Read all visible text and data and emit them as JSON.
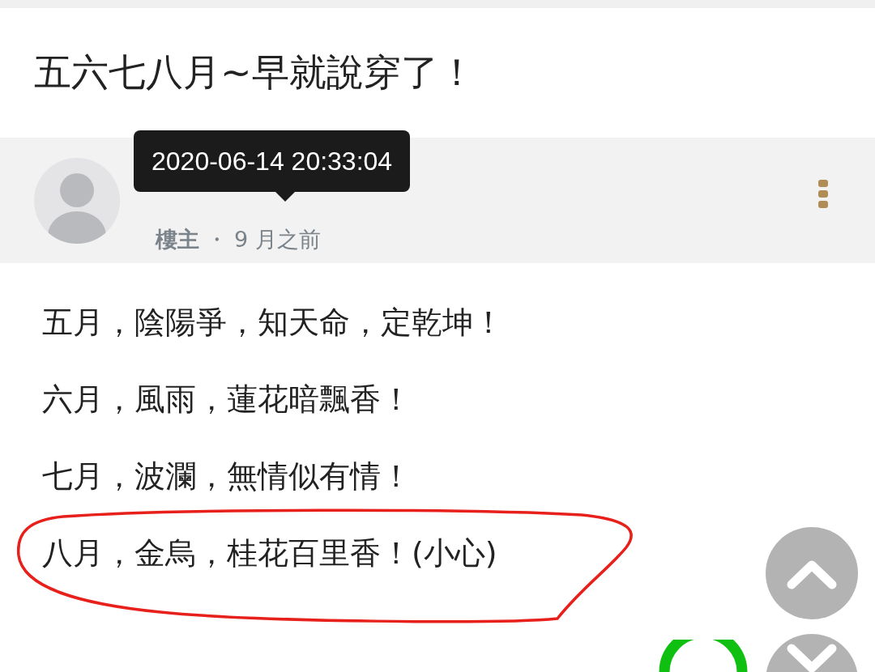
{
  "title": "五六七八月~早就說穿了！",
  "post": {
    "tooltip": "2020-06-14 20:33:04",
    "role": "樓主",
    "separator": "・",
    "time": "9 月之前"
  },
  "lines": [
    {
      "text": "五月，陰陽爭，知天命，定乾坤！",
      "circled": false
    },
    {
      "text": "六月，風雨，蓮花暗飄香！",
      "circled": false
    },
    {
      "text": "七月，波瀾，無情似有情！",
      "circled": false
    },
    {
      "text": "八月，金烏，桂花百里香！(小心)",
      "circled": true
    }
  ]
}
